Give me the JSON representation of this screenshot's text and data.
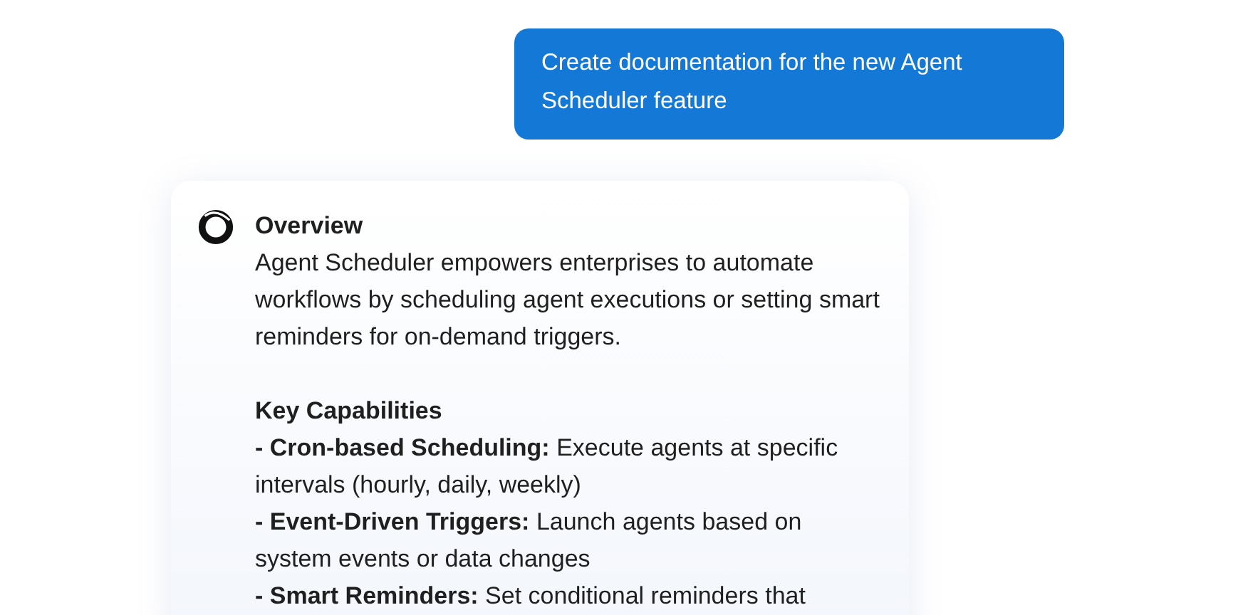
{
  "user_message": {
    "text": "Create documentation for the new Agent Scheduler feature"
  },
  "reply": {
    "sections": [
      {
        "heading": "Overview",
        "paragraphs": [
          "Agent Scheduler empowers enterprises to automate workflows by scheduling agent executions or setting smart reminders for on-demand triggers."
        ]
      },
      {
        "heading": "Key Capabilities",
        "items": [
          "**- Cron-based Scheduling:** Execute agents at specific intervals (hourly, daily, weekly)",
          "**- Event-Driven Triggers:** Launch agents based on system events or data changes",
          "**- Smart Reminders:** Set conditional reminders that"
        ]
      }
    ]
  }
}
